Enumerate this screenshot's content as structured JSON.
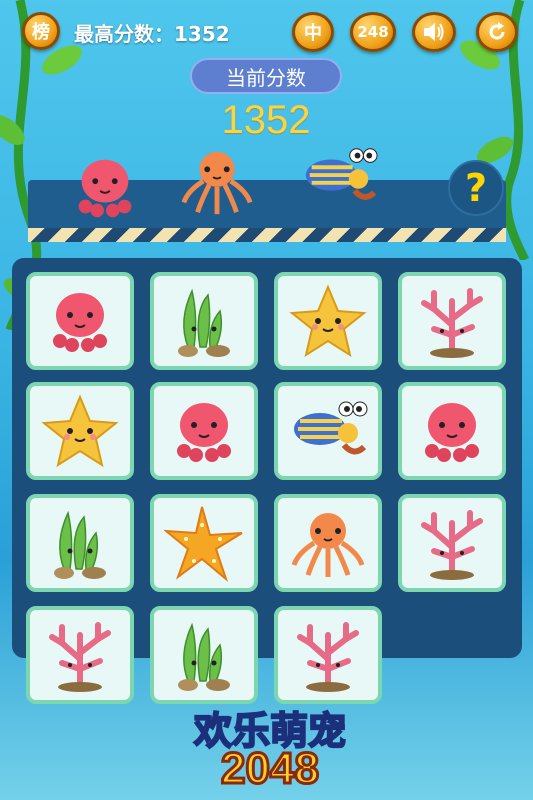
{
  "header": {
    "leaderboard_label": "榜",
    "best_score_label": "最高分数：1352",
    "difficulty_label": "中",
    "mode_label": "248",
    "sound_icon": "speaker-icon",
    "restart_icon": "restart-icon"
  },
  "score": {
    "current_label": "当前分数",
    "current_value": "1352"
  },
  "preview": {
    "items": [
      "octopus-red",
      "octopus-orange",
      "hermit-crab"
    ],
    "help_label": "?"
  },
  "board": {
    "rows": [
      [
        "octopus-red",
        "seaweed",
        "starfish-yellow",
        "coral-pink"
      ],
      [
        "starfish-yellow",
        "octopus-red",
        "hermit-crab",
        "octopus-red"
      ],
      [
        "seaweed",
        "starfish-orange",
        "octopus-orange",
        "coral-pink"
      ],
      [
        "coral-pink",
        "seaweed",
        "coral-pink",
        ""
      ]
    ]
  },
  "logo": {
    "title": "欢乐萌宠",
    "number": "2048"
  }
}
